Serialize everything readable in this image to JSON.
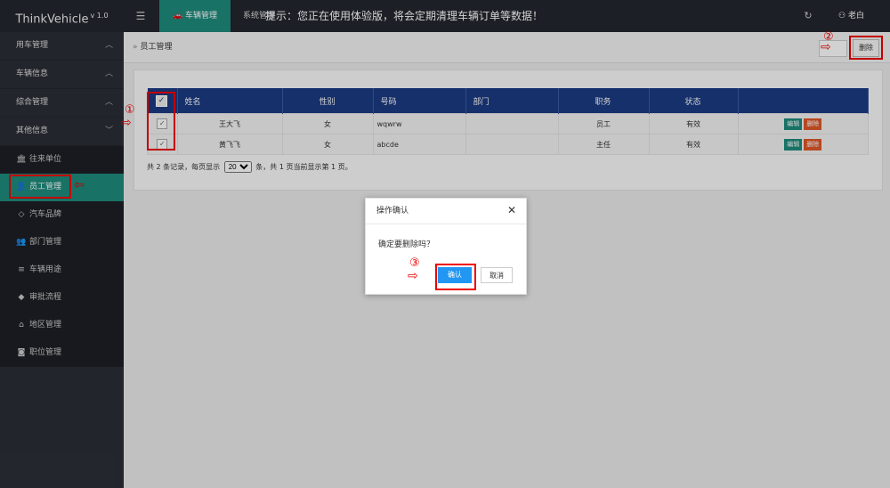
{
  "topbar": {
    "brand": "ThinkVehicle",
    "version": "v 1.0",
    "menu_icon": "hamburger-icon",
    "active_nav": "车辆管理",
    "sys_nav": "系统管理",
    "notice": "提示：您正在使用体验版，将会定期清理车辆订单等数据！",
    "user": "老白"
  },
  "sidebar": {
    "groups": [
      {
        "label": "用车管理",
        "chevron": "^"
      },
      {
        "label": "车辆信息",
        "chevron": "^"
      },
      {
        "label": "综合管理",
        "chevron": "^"
      },
      {
        "label": "其他信息",
        "chevron": "v"
      }
    ],
    "items": [
      {
        "label": "往来单位",
        "icon": "bank-icon"
      },
      {
        "label": "员工管理",
        "icon": "user-icon"
      },
      {
        "label": "汽车品牌",
        "icon": "diamond-icon"
      },
      {
        "label": "部门管理",
        "icon": "users-icon"
      },
      {
        "label": "车辆用途",
        "icon": "list-icon"
      },
      {
        "label": "审批流程",
        "icon": "android-icon"
      },
      {
        "label": "地区管理",
        "icon": "home-icon"
      },
      {
        "label": "职位管理",
        "icon": "camera-icon"
      }
    ]
  },
  "breadcrumb": {
    "label": "员工管理"
  },
  "toolbar": {
    "delete_label": "删除"
  },
  "table": {
    "headers": [
      "姓名",
      "性别",
      "号码",
      "部门",
      "职务",
      "状态"
    ],
    "rows": [
      {
        "name": "王大飞",
        "gender": "女",
        "phone": "wqwrw",
        "dept": "",
        "title": "员工",
        "status": "有效"
      },
      {
        "name": "黄飞飞",
        "gender": "女",
        "phone": "abcde",
        "dept": "",
        "title": "主任",
        "status": "有效"
      }
    ],
    "edit_label": "编辑",
    "delete_label": "删除"
  },
  "pager": {
    "prefix": "共 2 条记录，每页显示",
    "page_size": "20",
    "suffix": "条，共 1 页当前显示第 1 页。"
  },
  "dialog": {
    "title": "操作确认",
    "message": "确定要删除吗？",
    "ok_label": "确认",
    "cancel_label": "取消"
  },
  "annotations": {
    "step1": "①",
    "step2": "②",
    "step3": "③"
  },
  "colors": {
    "accent": "#1e8c7d",
    "header_blue": "#1c3b83",
    "primary": "#2196f3",
    "danger": "#e0582a",
    "annotation": "#e00000"
  }
}
